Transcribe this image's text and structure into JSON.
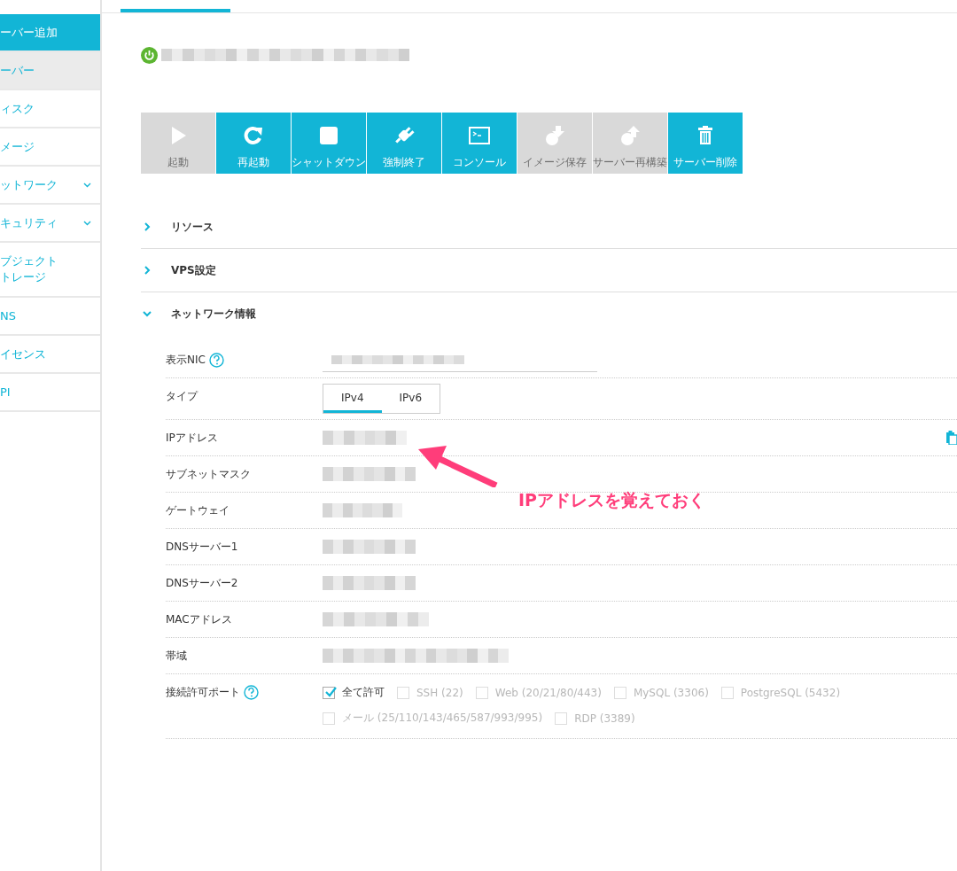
{
  "sidebar": {
    "items": [
      {
        "label": "ーバー追加",
        "kind": "action",
        "selected": false,
        "expandable": false
      },
      {
        "label": "ーバー",
        "kind": "link",
        "selected": true,
        "expandable": false
      },
      {
        "label": "ィスク",
        "kind": "link",
        "selected": false,
        "expandable": false
      },
      {
        "label": "メージ",
        "kind": "link",
        "selected": false,
        "expandable": false
      },
      {
        "label": "ットワーク",
        "kind": "link",
        "selected": false,
        "expandable": true
      },
      {
        "label": "キュリティ",
        "kind": "link",
        "selected": false,
        "expandable": true
      },
      {
        "label": "ブジェクト",
        "label_line_2": "トレージ",
        "kind": "link",
        "selected": false,
        "expandable": false
      },
      {
        "label": "NS",
        "kind": "link",
        "selected": false,
        "expandable": false
      },
      {
        "label": "イセンス",
        "kind": "link",
        "selected": false,
        "expandable": false
      },
      {
        "label": "PI",
        "kind": "link",
        "selected": false,
        "expandable": false
      }
    ]
  },
  "server": {
    "running": true
  },
  "toolbar": [
    {
      "label": "起動",
      "kind": "play",
      "disabled": true
    },
    {
      "label": "再起動",
      "kind": "restart",
      "disabled": false
    },
    {
      "label": "シャットダウン",
      "kind": "stop",
      "disabled": false
    },
    {
      "label": "強制終了",
      "kind": "plug",
      "disabled": false
    },
    {
      "label": "コンソール",
      "kind": "console",
      "disabled": false
    },
    {
      "label": "イメージ保存",
      "kind": "save",
      "disabled": true
    },
    {
      "label": "サーバー再構築",
      "kind": "rebuild",
      "disabled": true
    },
    {
      "label": "サーバー削除",
      "kind": "trash",
      "disabled": false
    }
  ],
  "sections": [
    {
      "title": "リソース",
      "expanded": false
    },
    {
      "title": "VPS設定",
      "expanded": false
    },
    {
      "title": "ネットワーク情報",
      "expanded": true
    }
  ],
  "network": {
    "rows": [
      {
        "label": "表示NIC",
        "help": true,
        "kind": "select"
      },
      {
        "label": "タイプ",
        "help": false,
        "kind": "tabs",
        "tabs": [
          {
            "label": "IPv4",
            "selected": true
          },
          {
            "label": "IPv6",
            "selected": false
          }
        ]
      },
      {
        "label": "IPアドレス",
        "help": false,
        "kind": "value",
        "copy": true
      },
      {
        "label": "サブネットマスク",
        "help": false,
        "kind": "value",
        "copy": false
      },
      {
        "label": "ゲートウェイ",
        "help": false,
        "kind": "value",
        "copy": false
      },
      {
        "label": "DNSサーバー1",
        "help": false,
        "kind": "value",
        "copy": false
      },
      {
        "label": "DNSサーバー2",
        "help": false,
        "kind": "value",
        "copy": false
      },
      {
        "label": "MACアドレス",
        "help": false,
        "kind": "value",
        "copy": false
      },
      {
        "label": "帯域",
        "help": false,
        "kind": "value",
        "copy": false
      },
      {
        "label": "接続許可ポート",
        "help": true,
        "kind": "checkboxes",
        "options": [
          {
            "label": "全て許可",
            "checked": true,
            "disabled": false
          },
          {
            "label": "SSH (22)",
            "checked": false,
            "disabled": true
          },
          {
            "label": "Web (20/21/80/443)",
            "checked": false,
            "disabled": true
          },
          {
            "label": "MySQL (3306)",
            "checked": false,
            "disabled": true
          },
          {
            "label": "PostgreSQL (5432)",
            "checked": false,
            "disabled": true
          },
          {
            "label": "メール (25/110/143/465/587/993/995)",
            "checked": false,
            "disabled": true
          },
          {
            "label": "RDP (3389)",
            "checked": false,
            "disabled": true
          }
        ]
      }
    ]
  },
  "annotation": {
    "text": "IPアドレスを覚えておく"
  }
}
